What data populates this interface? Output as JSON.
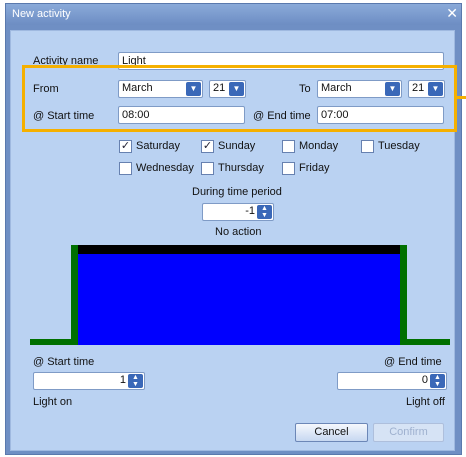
{
  "window": {
    "title": "New activity",
    "close_glyph": "✕"
  },
  "activity": {
    "name_label": "Activity name",
    "name_value": "Light"
  },
  "from": {
    "label": "From",
    "month": "March",
    "day": "21"
  },
  "to": {
    "label": "To",
    "month": "March",
    "day": "21"
  },
  "start_time": {
    "label": "@ Start time",
    "value": "08:00"
  },
  "end_time": {
    "label": "@ End time",
    "value": "07:00"
  },
  "days": [
    {
      "label": "Saturday",
      "checked": true
    },
    {
      "label": "Sunday",
      "checked": true
    },
    {
      "label": "Monday",
      "checked": false
    },
    {
      "label": "Tuesday",
      "checked": false
    },
    {
      "label": "Wednesday",
      "checked": false
    },
    {
      "label": "Thursday",
      "checked": false
    },
    {
      "label": "Friday",
      "checked": false
    }
  ],
  "period": {
    "label": "During time period",
    "value": "-1",
    "action": "No action"
  },
  "diagram": {
    "fill_color": "#0000ff",
    "line_color": "#007000",
    "top_color": "#000000"
  },
  "bottom": {
    "start_label": "@ Start time",
    "start_value": "1",
    "start_action": "Light on",
    "end_label": "@ End time",
    "end_value": "0",
    "end_action": "Light off"
  },
  "buttons": {
    "cancel": "Cancel",
    "confirm": "Confirm"
  },
  "icons": {
    "dropdown": "dropdown-arrow-icon",
    "spinner": "spinner-icon",
    "check": "✓"
  },
  "colors": {
    "highlight": "#f5b000",
    "title_bar": "#6d8dc3",
    "panel": "#bad2f2"
  }
}
